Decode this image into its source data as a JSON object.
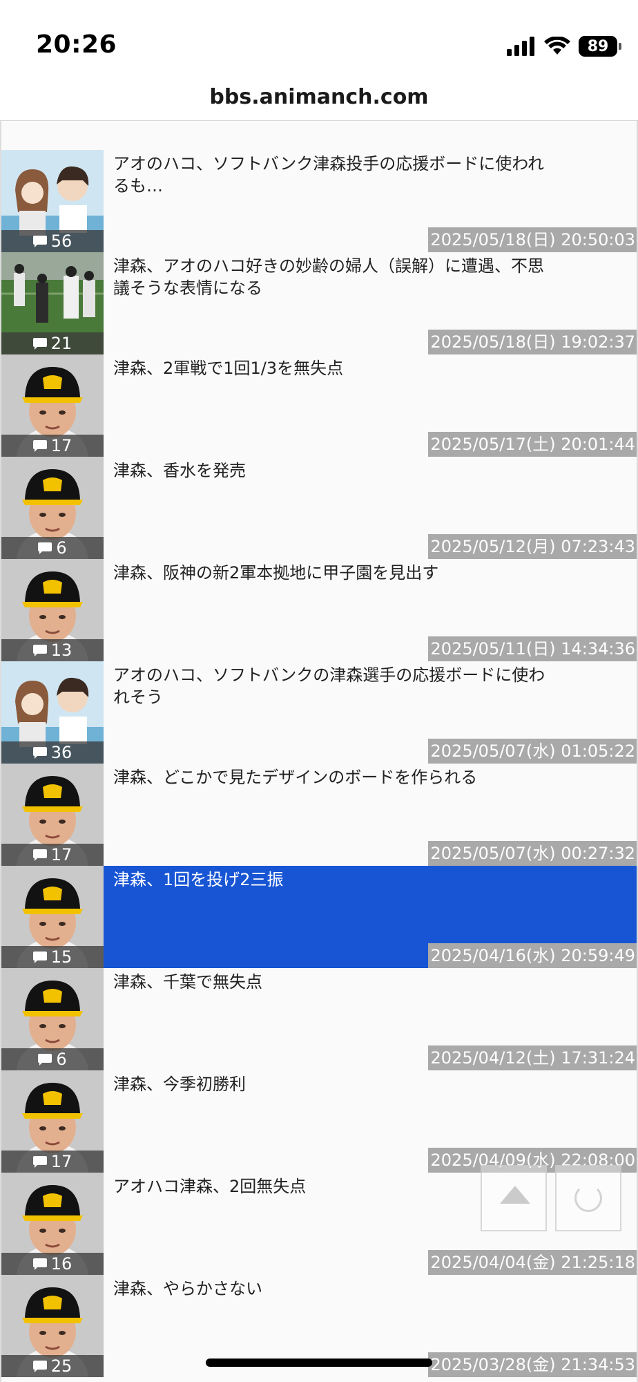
{
  "status_bar": {
    "time": "20:26",
    "battery": "89"
  },
  "browser": {
    "url": "bbs.animanch.com"
  },
  "threads": [
    {
      "title": "アオのハコ、ソフトバンク津森投手の応援ボードに使われるも…",
      "comments": "56",
      "date": "2025/05/18(日) 20:50:03",
      "thumb": "anime-illustration"
    },
    {
      "title": "津森、アオのハコ好きの妙齢の婦人（誤解）に遭遇、不思議そうな表情になる",
      "comments": "21",
      "date": "2025/05/18(日) 19:02:37",
      "thumb": "baseball-field-photo"
    },
    {
      "title": "津森、2軍戦で1回1/3を無失点",
      "comments": "17",
      "date": "2025/05/17(土) 20:01:44",
      "thumb": "player-portrait"
    },
    {
      "title": "津森、香水を発売",
      "comments": "6",
      "date": "2025/05/12(月) 07:23:43",
      "thumb": "player-portrait"
    },
    {
      "title": "津森、阪神の新2軍本拠地に甲子園を見出す",
      "comments": "13",
      "date": "2025/05/11(日) 14:34:36",
      "thumb": "player-portrait"
    },
    {
      "title": "アオのハコ、ソフトバンクの津森選手の応援ボードに使われそう",
      "comments": "36",
      "date": "2025/05/07(水) 01:05:22",
      "thumb": "anime-illustration"
    },
    {
      "title": "津森、どこかで見たデザインのボードを作られる",
      "comments": "17",
      "date": "2025/05/07(水) 00:27:32",
      "thumb": "player-portrait"
    },
    {
      "title": "津森、1回を投げ2三振",
      "comments": "15",
      "date": "2025/04/16(水) 20:59:49",
      "thumb": "player-portrait",
      "selected": true
    },
    {
      "title": "津森、千葉で無失点",
      "comments": "6",
      "date": "2025/04/12(土) 17:31:24",
      "thumb": "player-portrait"
    },
    {
      "title": "津森、今季初勝利",
      "comments": "17",
      "date": "2025/04/09(水) 22:08:00",
      "thumb": "player-portrait"
    },
    {
      "title": "アオハコ津森、2回無失点",
      "comments": "16",
      "date": "2025/04/04(金) 21:25:18",
      "thumb": "player-portrait"
    },
    {
      "title": "津森、やらかさない",
      "comments": "25",
      "date": "2025/03/28(金) 21:34:53",
      "thumb": "player-portrait"
    }
  ],
  "icons": {
    "comment": "comment-bubble-icon",
    "scroll_top": "arrow-up-icon",
    "reload": "reload-icon"
  },
  "colors": {
    "selected_row": "#1755d4",
    "date_badge": "#a9a9a9",
    "comment_badge": "#3c3c3c"
  }
}
